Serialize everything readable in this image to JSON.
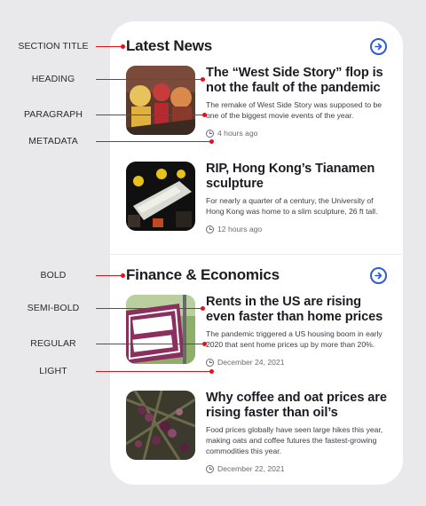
{
  "annotations": {
    "section_title": "SECTION TITLE",
    "heading": "HEADING",
    "paragraph": "PARAGRAPH",
    "metadata": "METADATA",
    "bold": "BOLD",
    "semi_bold": "SEMI-BOLD",
    "regular": "REGULAR",
    "light": "LIGHT"
  },
  "colors": {
    "annotation_line": "#e0131a",
    "accent": "#2e5bd6",
    "background": "#e9e9ec",
    "card": "#ffffff"
  },
  "sections": [
    {
      "title": "Latest News",
      "more_icon": "arrow-right-circle-icon",
      "articles": [
        {
          "headline": "The “West Side Story” flop is not the fault of the pandemic",
          "summary": "The remake of West Side Story was supposed to be one of the biggest movie events of the year.",
          "time": "4 hours ago"
        },
        {
          "headline": "RIP, Hong Kong’s Tianamen sculpture",
          "summary": "For nearly a quarter of a century, the University of Hong Kong was home to a slim sculpture, 26 ft tall.",
          "time": "12 hours ago"
        }
      ]
    },
    {
      "title": "Finance & Economics",
      "more_icon": "arrow-right-circle-icon",
      "articles": [
        {
          "headline": "Rents in the US are rising even faster than home prices",
          "summary": "The pandemic triggered a US housing boom in early 2020 that sent home prices up by more than 20%.",
          "time": "December 24, 2021"
        },
        {
          "headline": "Why coffee and oat prices are rising faster than oil’s",
          "summary": "Food prices globally have seen large hikes this year, making oats and coffee futures the fastest-growing commodities this year.",
          "time": "December 22, 2021"
        }
      ]
    }
  ]
}
